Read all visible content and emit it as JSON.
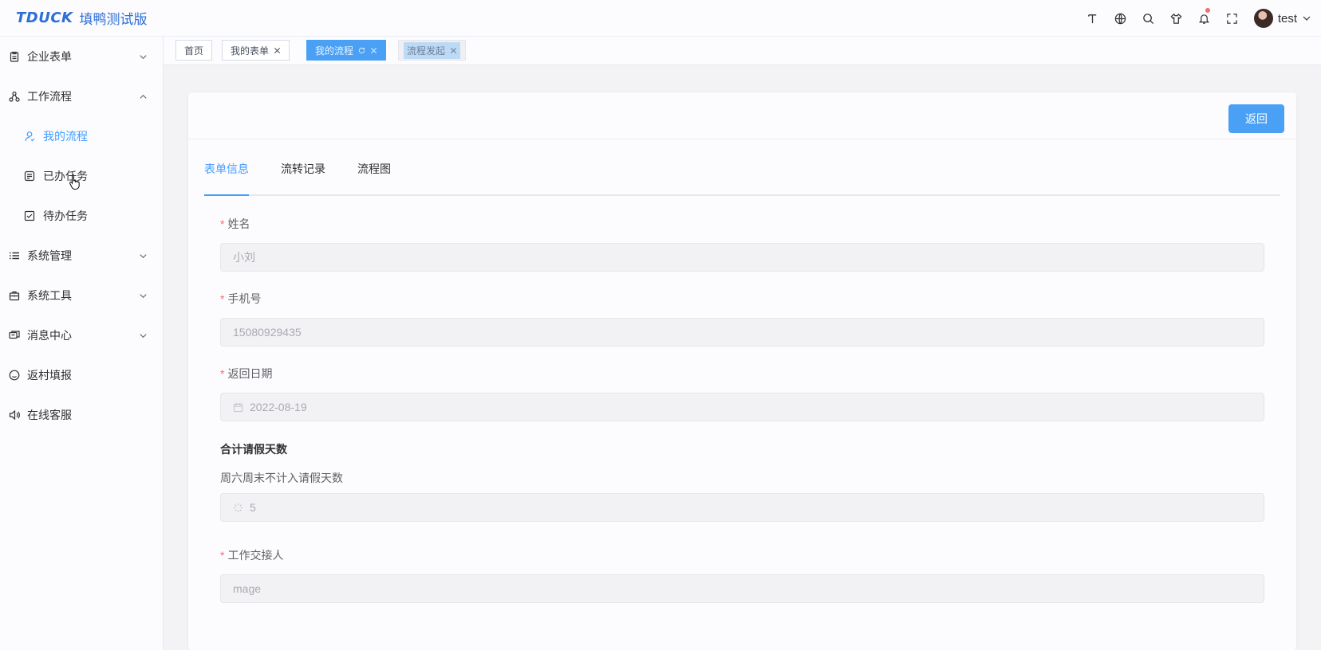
{
  "header": {
    "logo_mark": "TDUCK",
    "logo_title": "填鸭测试版",
    "user_name": "test",
    "tools": [
      "font-size-icon",
      "globe-icon",
      "search-icon",
      "theme-shirt-icon",
      "bell-icon",
      "fullscreen-icon"
    ]
  },
  "sidebar": {
    "items": [
      {
        "label": "企业表单",
        "icon": "clipboard-icon",
        "expanded": false
      },
      {
        "label": "工作流程",
        "icon": "flow-icon",
        "expanded": true
      },
      {
        "label": "我的流程",
        "icon": "user-icon",
        "sub": true,
        "active": true
      },
      {
        "label": "已办任务",
        "icon": "done-list-icon",
        "sub": true
      },
      {
        "label": "待办任务",
        "icon": "todo-check-icon",
        "sub": true
      },
      {
        "label": "系统管理",
        "icon": "list-icon",
        "expanded": false
      },
      {
        "label": "系统工具",
        "icon": "toolbox-icon",
        "expanded": false
      },
      {
        "label": "消息中心",
        "icon": "message-icon",
        "expanded": false
      },
      {
        "label": "返村填报",
        "icon": "chat-smile-icon"
      },
      {
        "label": "在线客服",
        "icon": "speaker-icon"
      }
    ]
  },
  "tags": [
    {
      "label": "首页"
    },
    {
      "label": "我的表单"
    },
    {
      "label": "我的流程"
    },
    {
      "label": "流程发起"
    }
  ],
  "card": {
    "back_label": "返回",
    "tabs": [
      "表单信息",
      "流转记录",
      "流程图"
    ],
    "fields": {
      "name": {
        "label": "姓名",
        "value": "小刘"
      },
      "phone": {
        "label": "手机号",
        "value": "15080929435"
      },
      "return_date": {
        "label": "返回日期",
        "value": "2022-08-19"
      },
      "leave_days": {
        "heading": "合计请假天数",
        "description": "周六周末不计入请假天数",
        "value": "5"
      },
      "handover": {
        "label": "工作交接人",
        "value": "mage"
      }
    }
  },
  "colors": {
    "accent": "#409eff",
    "brand": "#2d6fd6",
    "required": "#f56c6c"
  }
}
